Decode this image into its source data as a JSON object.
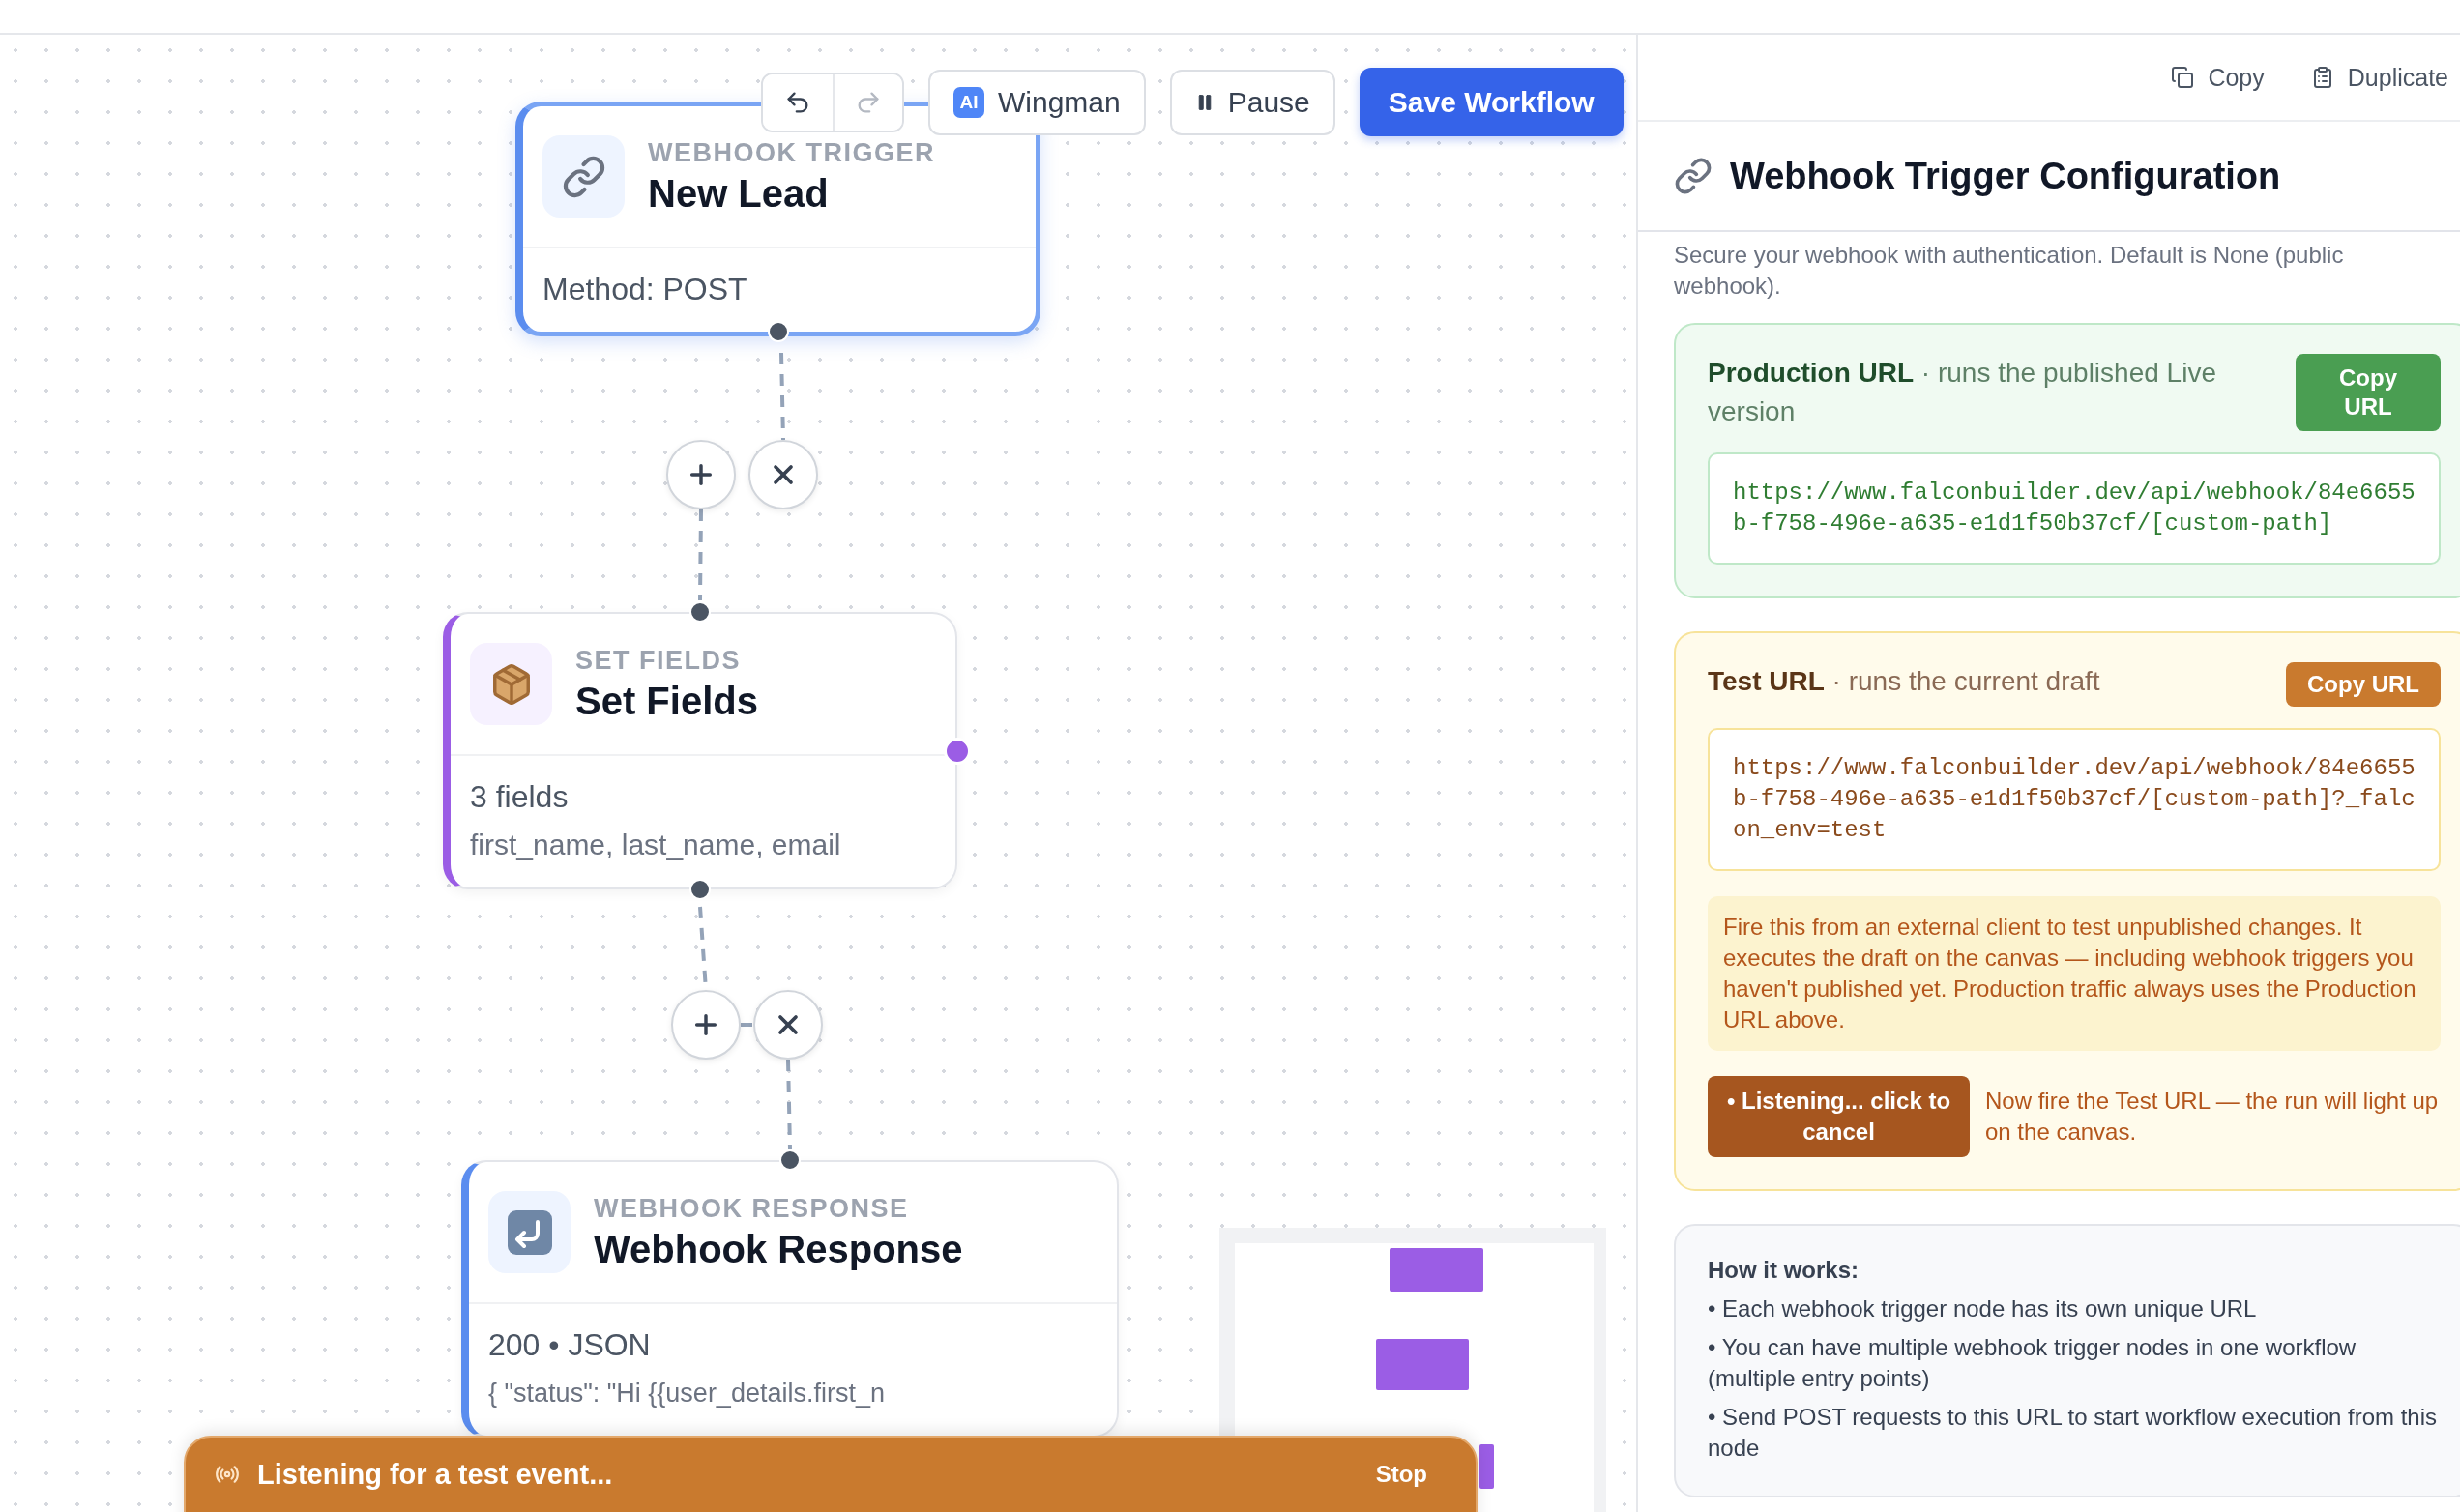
{
  "toolbar": {
    "undo": {
      "disabled": false
    },
    "redo": {
      "disabled": true
    },
    "wingman": {
      "badge": "AI",
      "label": "Wingman"
    },
    "pause": {
      "label": "Pause"
    },
    "save": {
      "label": "Save Workflow"
    }
  },
  "nodes": [
    {
      "kind": "webhook_trigger",
      "type_label": "WEBHOOK TRIGGER",
      "title": "New Lead",
      "body": "Method: POST",
      "selected": true,
      "color": "#5b8def",
      "output_handle": false
    },
    {
      "kind": "set_fields",
      "type_label": "SET FIELDS",
      "title": "Set Fields",
      "body": "3 fields",
      "detail": "first_name, last_name, email",
      "selected": false,
      "color": "#9b5de5",
      "output_handle": true
    },
    {
      "kind": "webhook_response",
      "type_label": "WEBHOOK RESPONSE",
      "title": "Webhook Response",
      "body": "200 • JSON",
      "detail": "{ \"status\": \"Hi {{user_details.first_n",
      "selected": false,
      "color": "#5b8def",
      "output_handle": false
    }
  ],
  "listening_bar": {
    "text": "Listening for a test event...",
    "stop": "Stop"
  },
  "panel": {
    "actions": [
      {
        "kind": "copy",
        "label": "Copy"
      },
      {
        "kind": "duplicate",
        "label": "Duplicate"
      }
    ],
    "title": "Webhook Trigger Configuration",
    "description": "Secure your webhook with authentication. Default is None (public webhook).",
    "production": {
      "heading": "**Production URL** · runs the published Live version",
      "button": "Copy URL",
      "url": "https://www.falconbuilder.dev/api/webhook/84e6655b-f758-496e-a635-e1d1f50b37cf/[custom-path]"
    },
    "test": {
      "heading": "**Test URL** · runs the current draft",
      "button": "Copy URL",
      "url": "https://www.falconbuilder.dev/api/webhook/84e6655b-f758-496e-a635-e1d1f50b37cf/[custom-path]?_falcon_env=test",
      "notice": "Fire this from an external client to test unpublished changes. It executes the draft on the canvas — including webhook triggers you haven't published yet. Production traffic always uses the Production URL above.",
      "listen_button": "• Listening... click to cancel",
      "listen_hint": "Now fire the Test URL — the run will light up on the canvas."
    },
    "how_it_works": {
      "title": "How it works:",
      "items": [
        "• Each webhook trigger node has its own unique URL",
        "• You can have multiple webhook trigger nodes in one workflow (multiple entry points)",
        "• Send POST requests to this URL to start workflow execution from this node"
      ]
    }
  }
}
